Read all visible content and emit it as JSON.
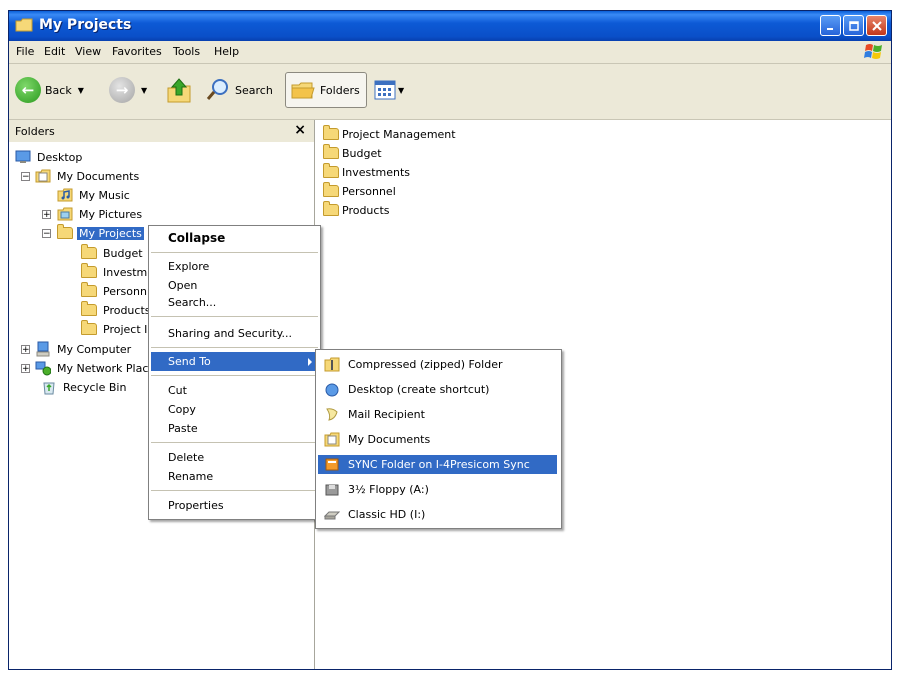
{
  "window": {
    "title": "My Projects"
  },
  "menu": [
    "File",
    "Edit",
    "View",
    "Favorites",
    "Tools",
    "Help"
  ],
  "toolbar": {
    "back": "Back",
    "search": "Search",
    "folders": "Folders"
  },
  "folders_pane": {
    "title": "Folders",
    "tree": {
      "desktop": "Desktop",
      "my_documents": "My Documents",
      "my_music": "My Music",
      "my_pictures": "My Pictures",
      "my_projects": "My Projects",
      "budget": "Budget",
      "investments": "Investm",
      "personnel": "Personn",
      "products": "Products",
      "project_management": "Project I",
      "my_computer": "My Computer",
      "my_network": "My Network Plac",
      "recycle_bin": "Recycle Bin"
    }
  },
  "content": {
    "items": [
      "Project Management",
      "Budget",
      "Investments",
      "Personnel",
      "Products"
    ]
  },
  "context_menu": {
    "collapse": "Collapse",
    "explore": "Explore",
    "open": "Open",
    "search": "Search...",
    "sharing": "Sharing and Security...",
    "send_to": "Send To",
    "cut": "Cut",
    "copy": "Copy",
    "paste": "Paste",
    "delete": "Delete",
    "rename": "Rename",
    "properties": "Properties"
  },
  "send_to_menu": {
    "compressed": "Compressed (zipped) Folder",
    "desktop": "Desktop (create shortcut)",
    "mail": "Mail Recipient",
    "my_documents": "My Documents",
    "sync": "SYNC Folder on I-4Presicom Sync",
    "floppy": "3½ Floppy (A:)",
    "classic_hd": "Classic HD (I:)"
  },
  "colors": {
    "selection": "#316ac5",
    "titlebar": "#0a5fd8",
    "chrome": "#ece9d8"
  }
}
